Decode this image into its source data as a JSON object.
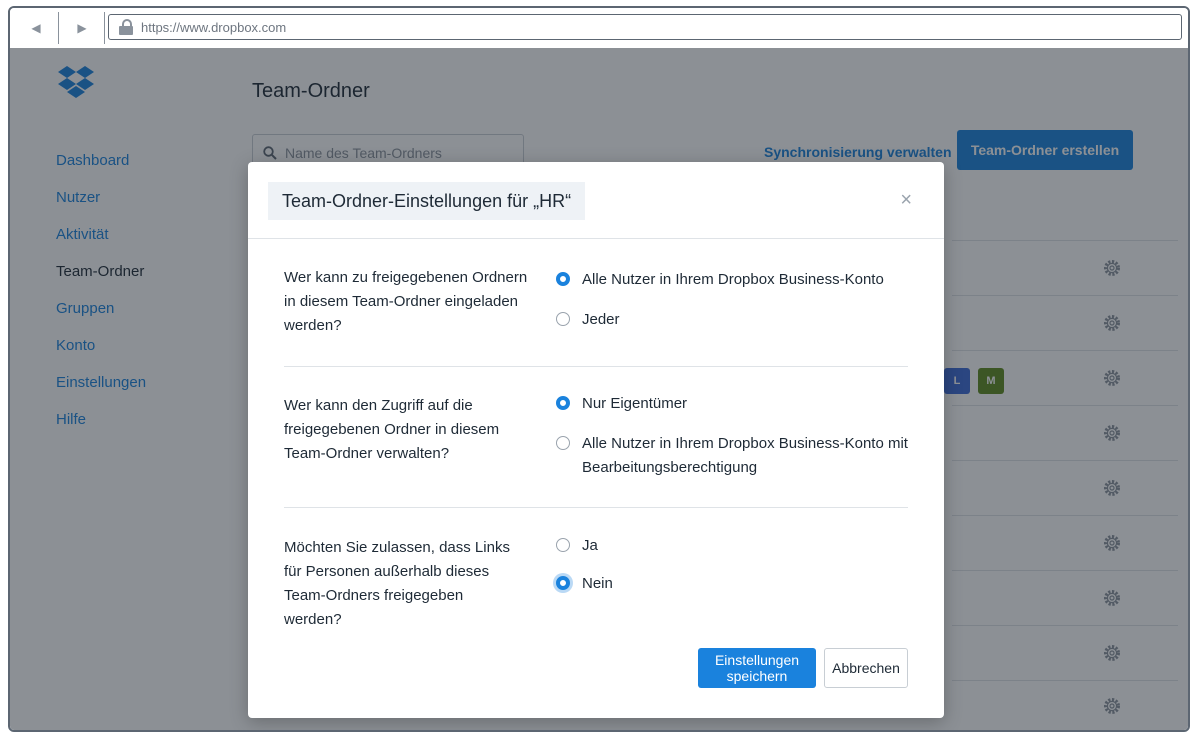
{
  "browser": {
    "url": "https://www.dropbox.com"
  },
  "page": {
    "title": "Team-Ordner",
    "search_placeholder": "Name des Team-Ordners",
    "sync_link": "Synchronisierung verwalten",
    "create_button": "Team-Ordner erstellen"
  },
  "sidebar": {
    "items": [
      {
        "label": "Dashboard"
      },
      {
        "label": "Nutzer"
      },
      {
        "label": "Aktivität"
      },
      {
        "label": "Team-Ordner"
      },
      {
        "label": "Gruppen"
      },
      {
        "label": "Konto"
      },
      {
        "label": "Einstellungen"
      },
      {
        "label": "Hilfe"
      }
    ]
  },
  "avatars": [
    {
      "letter": "L",
      "color": "#3d6ad6"
    },
    {
      "letter": "M",
      "color": "#5e8a1e"
    }
  ],
  "modal": {
    "title": "Team-Ordner-Einstellungen für „HR“",
    "close": "×",
    "sections": [
      {
        "question": "Wer kann zu freigegebenen Ordnern in diesem Team-Ordner eingeladen werden?",
        "options": [
          {
            "label": "Alle Nutzer in Ihrem Dropbox Business-Konto",
            "checked": true
          },
          {
            "label": "Jeder",
            "checked": false
          }
        ]
      },
      {
        "question": "Wer kann den Zugriff auf die freigegebenen Ordner in diesem Team-Ordner verwalten?",
        "options": [
          {
            "label": "Nur Eigentümer",
            "checked": true
          },
          {
            "label": "Alle Nutzer in Ihrem Dropbox Business-Konto mit Bearbeitungsberechtigung",
            "checked": false
          }
        ]
      },
      {
        "question": "Möchten Sie zulassen, dass Links für Personen außerhalb dieses Team-Ordners freigegeben werden?",
        "options": [
          {
            "label": "Ja",
            "checked": false
          },
          {
            "label": "Nein",
            "checked": true
          }
        ]
      }
    ],
    "save_button": "Einstellungen speichern",
    "cancel_button": "Abbrechen"
  },
  "colors": {
    "accent": "#1a82dd",
    "text": "#1e2a36"
  }
}
